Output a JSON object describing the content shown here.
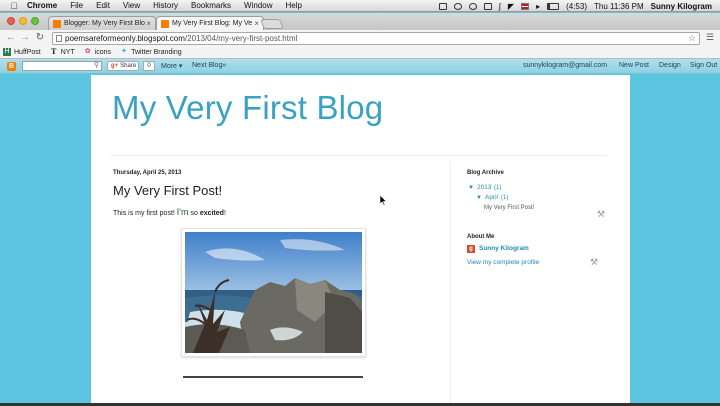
{
  "menubar": {
    "app": "Chrome",
    "items": [
      "File",
      "Edit",
      "View",
      "History",
      "Bookmarks",
      "Window",
      "Help"
    ],
    "battery": "(4:53)",
    "clock": "Thu 11:36 PM",
    "user": "Sunny Kilogram"
  },
  "tabs": [
    {
      "title": "Blogger: My Very First Blo",
      "active": false
    },
    {
      "title": "My Very First Blog: My Ve",
      "active": true
    }
  ],
  "toolbar": {
    "url_host": "poemsareformeonly.blogspot.com",
    "url_path": "/2013/04/my-very-first-post.html"
  },
  "bookmarks": [
    {
      "label": "HuffPost",
      "icon": "huffpost-icon"
    },
    {
      "label": "NYT",
      "icon": "nyt-icon"
    },
    {
      "label": "icons",
      "icon": "flower-icon"
    },
    {
      "label": "Twitter Branding",
      "icon": "twitter-icon"
    }
  ],
  "blogger_nav": {
    "share_label": "Share",
    "share_count": "0",
    "more_label": "More ▾",
    "next_blog_label": "Next Blog»",
    "email": "sunnykilogram@gmail.com",
    "new_post_label": "New Post",
    "design_label": "Design",
    "sign_out_label": "Sign Out"
  },
  "blog": {
    "title": "My Very First Blog",
    "post": {
      "date": "Thursday, April 25, 2013",
      "title": "My Very First Post!",
      "body_start": "This is my first post! ",
      "body_big": "I'm",
      "body_mid": " so ",
      "body_bold": "excited",
      "body_end": "!"
    }
  },
  "sidebar": {
    "archive_heading": "Blog Archive",
    "year": "2013",
    "year_count": "(1)",
    "month": "April",
    "month_count": "(1)",
    "post_link": "My Very First Post!",
    "about_heading": "About Me",
    "author_name": "Sunny Kilogram",
    "profile_link": "View my complete profile"
  },
  "colors": {
    "background": "#5cc6e0",
    "title": "#3aa2c0",
    "link": "#2288bb",
    "blogger_orange": "#f57d00"
  }
}
